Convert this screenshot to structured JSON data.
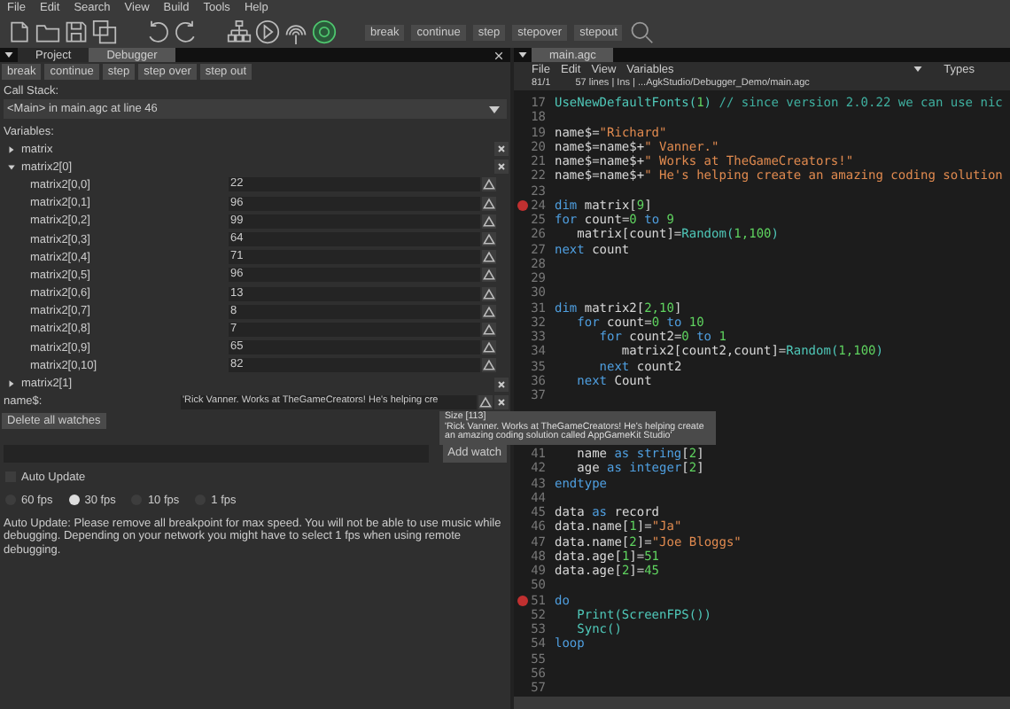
{
  "menu": [
    "File",
    "Edit",
    "Search",
    "View",
    "Build",
    "Tools",
    "Help"
  ],
  "toolbar": {
    "debug_buttons": [
      "break",
      "continue",
      "step",
      "stepover",
      "stepout"
    ]
  },
  "left_tabs": [
    {
      "label": "Project",
      "selected": false
    },
    {
      "label": "Debugger",
      "selected": true
    }
  ],
  "debugger": {
    "buttons": [
      "break",
      "continue",
      "step",
      "step over",
      "step out"
    ],
    "call_stack_label": "Call Stack:",
    "call_stack_value": "<Main> in main.agc at line 46",
    "variables_label": "Variables:",
    "variables": [
      {
        "name": "matrix",
        "expanded": false
      },
      {
        "name": "matrix2[0]",
        "expanded": true,
        "children": [
          {
            "name": "matrix2[0,0]",
            "value": "22"
          },
          {
            "name": "matrix2[0,1]",
            "value": "96"
          },
          {
            "name": "matrix2[0,2]",
            "value": "99"
          },
          {
            "name": "matrix2[0,3]",
            "value": "64"
          },
          {
            "name": "matrix2[0,4]",
            "value": "71"
          },
          {
            "name": "matrix2[0,5]",
            "value": "96"
          },
          {
            "name": "matrix2[0,6]",
            "value": "13"
          },
          {
            "name": "matrix2[0,7]",
            "value": "8"
          },
          {
            "name": "matrix2[0,8]",
            "value": "7"
          },
          {
            "name": "matrix2[0,9]",
            "value": "65"
          },
          {
            "name": "matrix2[0,10]",
            "value": "82"
          }
        ]
      },
      {
        "name": "matrix2[1]",
        "expanded": false
      }
    ],
    "watch": {
      "name": "name$:",
      "value": "'Rick Vanner. Works at TheGameCreators! He's helping cre"
    },
    "delete_all": "Delete all watches",
    "add_watch": "Add watch",
    "auto_update": {
      "label": "Auto Update",
      "checked": false
    },
    "fps": [
      {
        "label": "60 fps",
        "selected": false
      },
      {
        "label": "30 fps",
        "selected": true
      },
      {
        "label": "10 fps",
        "selected": false
      },
      {
        "label": "1 fps",
        "selected": false
      }
    ],
    "note": "Auto Update: Please remove all breakpoint for max speed. You will not be able to use music while debugging. Depending on your network you might have to select 1 fps when using remote debugging."
  },
  "editor": {
    "tab": "main.agc",
    "menu": [
      "File",
      "Edit",
      "View",
      "Variables"
    ],
    "types": "Types",
    "pos": "81/1",
    "info": "57 lines | Ins | ...AgkStudio/Debugger_Demo/main.agc",
    "lines": [
      {
        "n": "17",
        "bp": false,
        "t": [
          {
            "kind": "fn",
            "text": "UseNewDefaultFonts("
          },
          {
            "kind": "num",
            "text": "1"
          },
          {
            "kind": "fn",
            "text": ")"
          },
          {
            "kind": "cm",
            "text": " // since version 2.0.22 we can use nic"
          }
        ]
      },
      {
        "n": "18",
        "bp": false
      },
      {
        "n": "19",
        "bp": false,
        "t": [
          {
            "kind": "id",
            "text": "name$="
          },
          {
            "kind": "str",
            "text": "\"Richard\""
          }
        ]
      },
      {
        "n": "20",
        "bp": false,
        "t": [
          {
            "kind": "id",
            "text": "name$=name$+"
          },
          {
            "kind": "str",
            "text": "\" Vanner.\""
          }
        ]
      },
      {
        "n": "21",
        "bp": false,
        "t": [
          {
            "kind": "id",
            "text": "name$=name$+"
          },
          {
            "kind": "str",
            "text": "\" Works at TheGameCreators!\""
          }
        ]
      },
      {
        "n": "22",
        "bp": false,
        "t": [
          {
            "kind": "id",
            "text": "name$=name$+"
          },
          {
            "kind": "str",
            "text": "\" He's helping create an amazing coding solution"
          }
        ]
      },
      {
        "n": "23",
        "bp": false
      },
      {
        "n": "24",
        "bp": true,
        "t": [
          {
            "kind": "kw",
            "text": "dim"
          },
          {
            "kind": "id",
            "text": " matrix["
          },
          {
            "kind": "num",
            "text": "9"
          },
          {
            "kind": "id",
            "text": "]"
          }
        ]
      },
      {
        "n": "25",
        "bp": false,
        "t": [
          {
            "kind": "kw",
            "text": "for"
          },
          {
            "kind": "id",
            "text": " count="
          },
          {
            "kind": "num",
            "text": "0"
          },
          {
            "kind": "kw",
            "text": " to "
          },
          {
            "kind": "num",
            "text": "9"
          }
        ]
      },
      {
        "n": "26",
        "bp": false,
        "t": [
          {
            "kind": "id",
            "text": "   matrix[count]="
          },
          {
            "kind": "fn",
            "text": "Random("
          },
          {
            "kind": "num",
            "text": "1,100"
          },
          {
            "kind": "fn",
            "text": ")"
          }
        ]
      },
      {
        "n": "27",
        "bp": false,
        "t": [
          {
            "kind": "kw",
            "text": "next"
          },
          {
            "kind": "id",
            "text": " count"
          }
        ]
      },
      {
        "n": "28",
        "bp": false
      },
      {
        "n": "29",
        "bp": false
      },
      {
        "n": "30",
        "bp": false
      },
      {
        "n": "31",
        "bp": false,
        "t": [
          {
            "kind": "kw",
            "text": "dim"
          },
          {
            "kind": "id",
            "text": " matrix2["
          },
          {
            "kind": "num",
            "text": "2,10"
          },
          {
            "kind": "id",
            "text": "]"
          }
        ]
      },
      {
        "n": "32",
        "bp": false,
        "t": [
          {
            "kind": "kw",
            "text": "   for"
          },
          {
            "kind": "id",
            "text": " count="
          },
          {
            "kind": "num",
            "text": "0"
          },
          {
            "kind": "kw",
            "text": " to "
          },
          {
            "kind": "num",
            "text": "10"
          }
        ]
      },
      {
        "n": "33",
        "bp": false,
        "t": [
          {
            "kind": "kw",
            "text": "      for"
          },
          {
            "kind": "id",
            "text": " count2="
          },
          {
            "kind": "num",
            "text": "0"
          },
          {
            "kind": "kw",
            "text": " to "
          },
          {
            "kind": "num",
            "text": "1"
          }
        ]
      },
      {
        "n": "34",
        "bp": false,
        "t": [
          {
            "kind": "id",
            "text": "         matrix2[count2,count]="
          },
          {
            "kind": "fn",
            "text": "Random("
          },
          {
            "kind": "num",
            "text": "1,100"
          },
          {
            "kind": "fn",
            "text": ")"
          }
        ]
      },
      {
        "n": "35",
        "bp": false,
        "t": [
          {
            "kind": "kw",
            "text": "      next"
          },
          {
            "kind": "id",
            "text": " count2"
          }
        ]
      },
      {
        "n": "36",
        "bp": false,
        "t": [
          {
            "kind": "kw",
            "text": "   next"
          },
          {
            "kind": "id",
            "text": " Count"
          }
        ]
      },
      {
        "n": "37",
        "bp": false
      },
      {
        "covered": true
      },
      {
        "covered": true
      },
      {
        "covered": true
      },
      {
        "n": "41",
        "bp": false,
        "t": [
          {
            "kind": "id",
            "text": "   name "
          },
          {
            "kind": "kw",
            "text": "as string"
          },
          {
            "kind": "id",
            "text": "["
          },
          {
            "kind": "num",
            "text": "2"
          },
          {
            "kind": "id",
            "text": "]"
          }
        ]
      },
      {
        "n": "42",
        "bp": false,
        "t": [
          {
            "kind": "id",
            "text": "   age "
          },
          {
            "kind": "kw",
            "text": "as integer"
          },
          {
            "kind": "id",
            "text": "["
          },
          {
            "kind": "num",
            "text": "2"
          },
          {
            "kind": "id",
            "text": "]"
          }
        ]
      },
      {
        "n": "43",
        "bp": false,
        "t": [
          {
            "kind": "kw",
            "text": "endtype"
          }
        ]
      },
      {
        "n": "44",
        "bp": false
      },
      {
        "n": "45",
        "bp": false,
        "t": [
          {
            "kind": "id",
            "text": "data "
          },
          {
            "kind": "kw",
            "text": "as"
          },
          {
            "kind": "id",
            "text": " record"
          }
        ]
      },
      {
        "n": "46",
        "bp": false,
        "t": [
          {
            "kind": "id",
            "text": "data.name["
          },
          {
            "kind": "num",
            "text": "1"
          },
          {
            "kind": "id",
            "text": "]="
          },
          {
            "kind": "str",
            "text": "\"Ja\""
          }
        ]
      },
      {
        "n": "47",
        "bp": false,
        "t": [
          {
            "kind": "id",
            "text": "data.name["
          },
          {
            "kind": "num",
            "text": "2"
          },
          {
            "kind": "id",
            "text": "]="
          },
          {
            "kind": "str",
            "text": "\"Joe Bloggs\""
          }
        ]
      },
      {
        "n": "48",
        "bp": false,
        "t": [
          {
            "kind": "id",
            "text": "data.age["
          },
          {
            "kind": "num",
            "text": "1"
          },
          {
            "kind": "id",
            "text": "]="
          },
          {
            "kind": "num",
            "text": "51"
          }
        ]
      },
      {
        "n": "49",
        "bp": false,
        "t": [
          {
            "kind": "id",
            "text": "data.age["
          },
          {
            "kind": "num",
            "text": "2"
          },
          {
            "kind": "id",
            "text": "]="
          },
          {
            "kind": "num",
            "text": "45"
          }
        ]
      },
      {
        "n": "50",
        "bp": false
      },
      {
        "n": "51",
        "bp": true,
        "t": [
          {
            "kind": "kw",
            "text": "do"
          }
        ]
      },
      {
        "n": "52",
        "bp": false,
        "t": [
          {
            "kind": "fn",
            "text": "   Print(ScreenFPS())"
          }
        ]
      },
      {
        "n": "53",
        "bp": false,
        "t": [
          {
            "kind": "fn",
            "text": "   Sync()"
          }
        ]
      },
      {
        "n": "54",
        "bp": false,
        "t": [
          {
            "kind": "kw",
            "text": "loop"
          }
        ]
      },
      {
        "n": "55",
        "bp": false
      },
      {
        "n": "56",
        "bp": false
      },
      {
        "n": "57",
        "bp": false
      }
    ]
  },
  "tooltip": {
    "title": "Size [113]",
    "text": "'Rick Vanner. Works at TheGameCreators! He's helping create an amazing coding solution called AppGameKit Studio'"
  }
}
